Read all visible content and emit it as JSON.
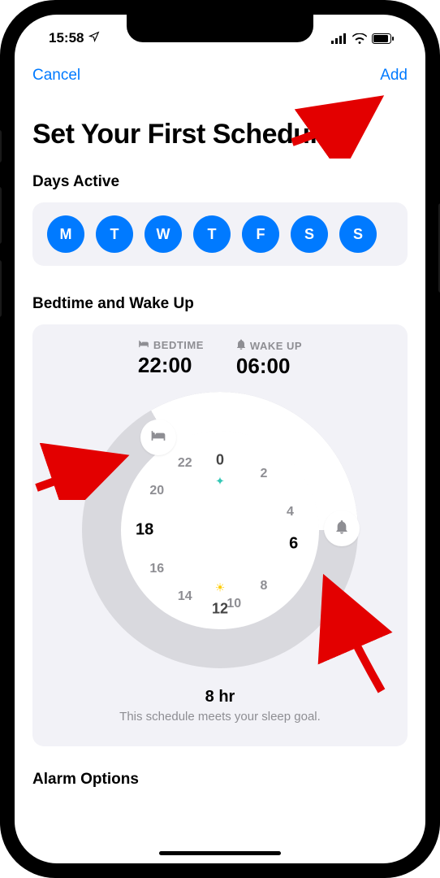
{
  "status": {
    "time": "15:58"
  },
  "nav": {
    "cancel_label": "Cancel",
    "add_label": "Add"
  },
  "title": "Set Your First Schedule",
  "days": {
    "section_title": "Days Active",
    "items": [
      "M",
      "T",
      "W",
      "T",
      "F",
      "S",
      "S"
    ]
  },
  "bedtime": {
    "section_title": "Bedtime and Wake Up",
    "bed_label": "BEDTIME",
    "bed_value": "22:00",
    "wake_label": "WAKE UP",
    "wake_value": "06:00",
    "clock_numbers": {
      "n0": "0",
      "n2": "2",
      "n4": "4",
      "n6": "6",
      "n8": "8",
      "n10": "10",
      "n12": "12",
      "n14": "14",
      "n16": "16",
      "n18": "18",
      "n20": "20",
      "n22": "22"
    },
    "duration": "8 hr",
    "goal_note": "This schedule meets your sleep goal."
  },
  "alarm": {
    "section_title": "Alarm Options"
  }
}
